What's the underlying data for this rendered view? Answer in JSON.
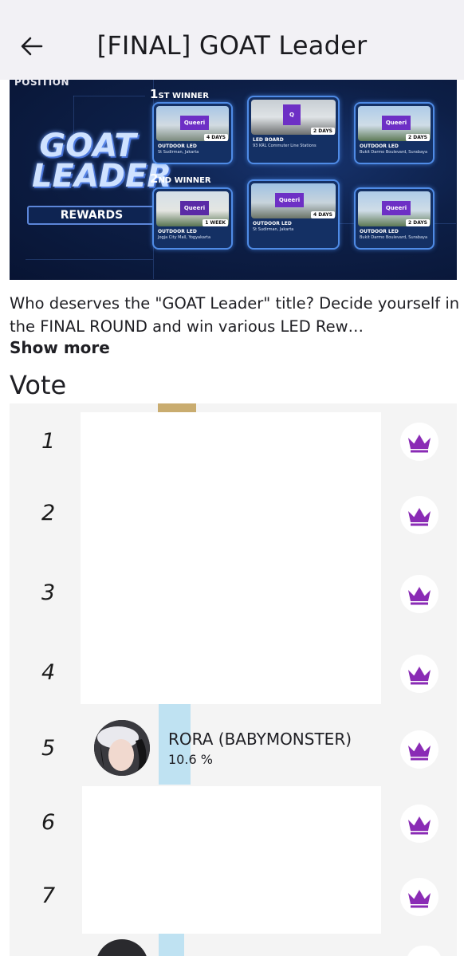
{
  "header": {
    "title": "[FINAL] GOAT Leader",
    "back_icon": "arrow-left-icon"
  },
  "banner": {
    "logo_text": "POSITION",
    "event_title_line1": "GOAT",
    "event_title_line2": "LEADER",
    "rewards_label": "REWARDS",
    "first_winner_label": {
      "ordinal": "1",
      "suffix": "ST WINNER"
    },
    "second_winner_label": {
      "ordinal": "2",
      "suffix": "ND WINNER"
    },
    "first_winner_cards": [
      {
        "type": "OUTDOOR LED",
        "location": "St Sudirman, Jakarta",
        "duration": "4 DAYS",
        "screen": "Queeri"
      },
      {
        "type": "LED BOARD",
        "location": "93 KRL Commuter Line Stations",
        "duration": "2 DAYS",
        "screen": "Q"
      },
      {
        "type": "OUTDOOR LED",
        "location": "Bukit Darmo Boulevard, Surabaya",
        "duration": "2 DAYS",
        "screen": "Queeri"
      }
    ],
    "second_winner_cards": [
      {
        "type": "OUTDOOR LED",
        "location": "Jogja City Mall, Yogyakarta",
        "duration": "1 WEEK",
        "screen": "Queeri"
      },
      {
        "type": "OUTDOOR LED",
        "location": "St Sudirman, Jakarta",
        "duration": "4 DAYS",
        "screen": "Queeri"
      },
      {
        "type": "OUTDOOR LED",
        "location": "Bukit Darmo Boulevard, Surabaya",
        "duration": "2 DAYS",
        "screen": "Queeri"
      }
    ]
  },
  "description": {
    "text": "Who deserves the \"GOAT Leader\" title? Decide yourself in the FINAL ROUND and win various LED Rew…",
    "show_more": "Show more"
  },
  "vote": {
    "section_title": "Vote",
    "crown_icon": "crown-icon",
    "ranks": [
      {
        "rank": "1"
      },
      {
        "rank": "2"
      },
      {
        "rank": "3"
      },
      {
        "rank": "4"
      },
      {
        "rank": "5",
        "name": "RORA (BABYMONSTER)",
        "percent_text": "10.6 %",
        "percent": 10.6
      },
      {
        "rank": "6"
      },
      {
        "rank": "7"
      }
    ],
    "colors": {
      "crown": "#8a2bb5",
      "percent_bar": "#bfe2f2",
      "gold_bar": "#c9ac6f"
    }
  }
}
